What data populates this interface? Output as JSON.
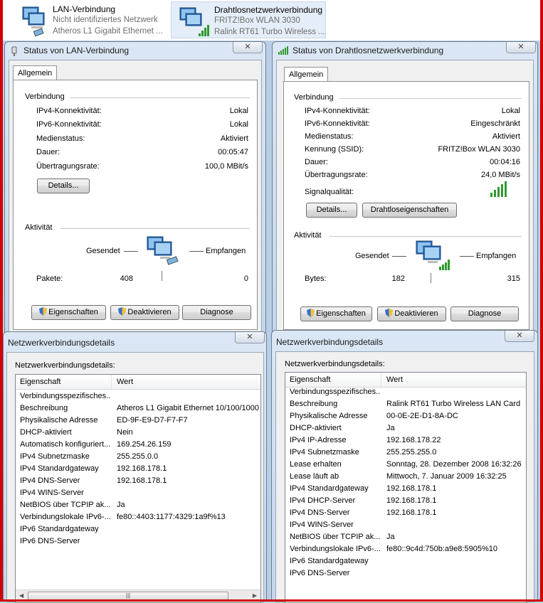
{
  "adapters": [
    {
      "name": "LAN-Verbindung",
      "status": "Nicht identifiziertes Netzwerk",
      "device": "Atheros L1 Gigabit Ethernet ..."
    },
    {
      "name": "Drahtlosnetzwerkverbindung",
      "status": "FRITZ!Box WLAN 3030",
      "device": "Ralink RT61 Turbo Wireless ..."
    }
  ],
  "lan_status": {
    "title": "Status von LAN-Verbindung",
    "close": "✕",
    "tab": "Allgemein",
    "connection_header": "Verbindung",
    "rows": [
      {
        "label": "IPv4-Konnektivität:",
        "value": "Lokal"
      },
      {
        "label": "IPv6-Konnektivität:",
        "value": "Lokal"
      },
      {
        "label": "Medienstatus:",
        "value": "Aktiviert"
      },
      {
        "label": "Dauer:",
        "value": "00:05:47"
      },
      {
        "label": "Übertragungsrate:",
        "value": "100,0 MBit/s"
      }
    ],
    "details_button": "Details...",
    "activity_header": "Aktivität",
    "sent_label": "Gesendet",
    "received_label": "Empfangen",
    "counter_label": "Pakete:",
    "sent_value": "408",
    "received_value": "0",
    "properties_button": "Eigenschaften",
    "disable_button": "Deaktivieren",
    "diagnose_button": "Diagnose"
  },
  "wlan_status": {
    "title": "Status von Drahtlosnetzwerkverbindung",
    "close": "✕",
    "tab": "Allgemein",
    "connection_header": "Verbindung",
    "rows": [
      {
        "label": "IPv4-Konnektivität:",
        "value": "Lokal"
      },
      {
        "label": "IPv6-Konnektivität:",
        "value": "Eingeschränkt"
      },
      {
        "label": "Medienstatus:",
        "value": "Aktiviert"
      },
      {
        "label": "Kennung (SSID):",
        "value": "FRITZ!Box WLAN 3030"
      },
      {
        "label": "Dauer:",
        "value": "00:04:16"
      },
      {
        "label": "Übertragungsrate:",
        "value": "24,0 MBit/s"
      }
    ],
    "signal_label": "Signalqualität:",
    "signal_level": 5,
    "details_button": "Details...",
    "wireless_props_button": "Drahtloseigenschaften",
    "activity_header": "Aktivität",
    "sent_label": "Gesendet",
    "received_label": "Empfangen",
    "counter_label": "Bytes:",
    "sent_value": "182",
    "received_value": "315",
    "properties_button": "Eigenschaften",
    "disable_button": "Deaktivieren",
    "diagnose_button": "Diagnose"
  },
  "lan_details": {
    "title": "Netzwerkverbindungsdetails",
    "close": "✕",
    "caption": "Netzwerkverbindungsdetails:",
    "col_property": "Eigenschaft",
    "col_value": "Wert",
    "rows": [
      {
        "k": "Verbindungsspezifisches...",
        "v": ""
      },
      {
        "k": "Beschreibung",
        "v": "Atheros L1 Gigabit Ethernet 10/100/1000"
      },
      {
        "k": "Physikalische Adresse",
        "v": "ED-9F-E9-D7-F7-F7"
      },
      {
        "k": "DHCP-aktiviert",
        "v": "Nein"
      },
      {
        "k": "Automatisch konfiguriert...",
        "v": "169.254.26.159"
      },
      {
        "k": "IPv4 Subnetzmaske",
        "v": "255.255.0.0"
      },
      {
        "k": "IPv4 Standardgateway",
        "v": "192.168.178.1"
      },
      {
        "k": "IPv4 DNS-Server",
        "v": "192.168.178.1"
      },
      {
        "k": "IPv4 WINS-Server",
        "v": ""
      },
      {
        "k": "NetBIOS über TCPIP ak...",
        "v": "Ja"
      },
      {
        "k": "Verbindungslokale IPv6-...",
        "v": "fe80::4403:1177:4329:1a9f%13"
      },
      {
        "k": "IPv6 Standardgateway",
        "v": ""
      },
      {
        "k": "IPv6 DNS-Server",
        "v": ""
      }
    ]
  },
  "wlan_details": {
    "title": "Netzwerkverbindungsdetails",
    "close": "✕",
    "caption": "Netzwerkverbindungsdetails:",
    "col_property": "Eigenschaft",
    "col_value": "Wert",
    "rows": [
      {
        "k": "Verbindungsspezifisches...",
        "v": ""
      },
      {
        "k": "Beschreibung",
        "v": "Ralink RT61 Turbo Wireless LAN Card"
      },
      {
        "k": "Physikalische Adresse",
        "v": "00-0E-2E-D1-8A-DC"
      },
      {
        "k": "DHCP-aktiviert",
        "v": "Ja"
      },
      {
        "k": "IPv4 IP-Adresse",
        "v": "192.168.178.22"
      },
      {
        "k": "IPv4 Subnetzmaske",
        "v": "255.255.255.0"
      },
      {
        "k": "Lease erhalten",
        "v": "Sonntag, 28. Dezember 2008 16:32:26"
      },
      {
        "k": "Lease läuft ab",
        "v": "Mittwoch, 7. Januar 2009 16:32:25"
      },
      {
        "k": "IPv4 Standardgateway",
        "v": "192.168.178.1"
      },
      {
        "k": "IPv4 DHCP-Server",
        "v": "192.168.178.1"
      },
      {
        "k": "IPv4 DNS-Server",
        "v": "192.168.178.1"
      },
      {
        "k": "IPv4 WINS-Server",
        "v": ""
      },
      {
        "k": "NetBIOS über TCPIP ak...",
        "v": "Ja"
      },
      {
        "k": "Verbindungslokale IPv6-...",
        "v": "fe80::9c4d:750b:a9e8:5905%10"
      },
      {
        "k": "IPv6 Standardgateway",
        "v": ""
      },
      {
        "k": "IPv6 DNS-Server",
        "v": ""
      }
    ]
  },
  "colors": {
    "frame_red": "#d40000",
    "signal_green": "#2f9a2f",
    "window_blue": "#c4d6ec"
  }
}
